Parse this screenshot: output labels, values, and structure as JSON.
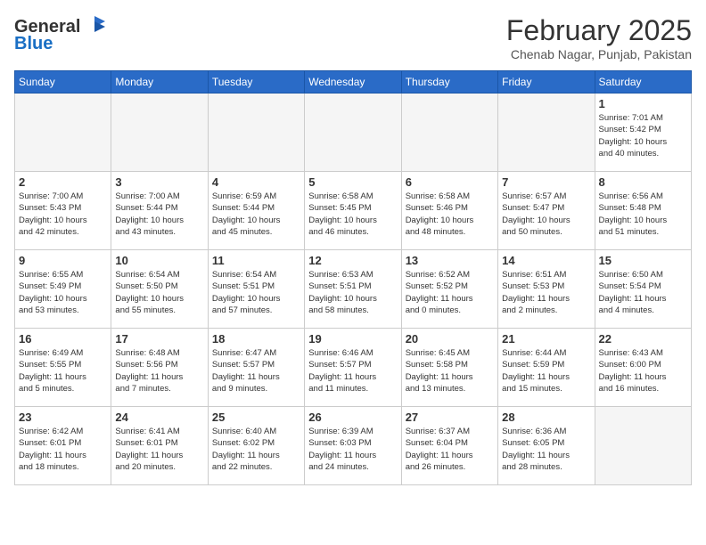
{
  "header": {
    "logo_general": "General",
    "logo_blue": "Blue",
    "month": "February 2025",
    "location": "Chenab Nagar, Punjab, Pakistan"
  },
  "weekdays": [
    "Sunday",
    "Monday",
    "Tuesday",
    "Wednesday",
    "Thursday",
    "Friday",
    "Saturday"
  ],
  "weeks": [
    [
      {
        "day": "",
        "info": ""
      },
      {
        "day": "",
        "info": ""
      },
      {
        "day": "",
        "info": ""
      },
      {
        "day": "",
        "info": ""
      },
      {
        "day": "",
        "info": ""
      },
      {
        "day": "",
        "info": ""
      },
      {
        "day": "1",
        "info": "Sunrise: 7:01 AM\nSunset: 5:42 PM\nDaylight: 10 hours\nand 40 minutes."
      }
    ],
    [
      {
        "day": "2",
        "info": "Sunrise: 7:00 AM\nSunset: 5:43 PM\nDaylight: 10 hours\nand 42 minutes."
      },
      {
        "day": "3",
        "info": "Sunrise: 7:00 AM\nSunset: 5:44 PM\nDaylight: 10 hours\nand 43 minutes."
      },
      {
        "day": "4",
        "info": "Sunrise: 6:59 AM\nSunset: 5:44 PM\nDaylight: 10 hours\nand 45 minutes."
      },
      {
        "day": "5",
        "info": "Sunrise: 6:58 AM\nSunset: 5:45 PM\nDaylight: 10 hours\nand 46 minutes."
      },
      {
        "day": "6",
        "info": "Sunrise: 6:58 AM\nSunset: 5:46 PM\nDaylight: 10 hours\nand 48 minutes."
      },
      {
        "day": "7",
        "info": "Sunrise: 6:57 AM\nSunset: 5:47 PM\nDaylight: 10 hours\nand 50 minutes."
      },
      {
        "day": "8",
        "info": "Sunrise: 6:56 AM\nSunset: 5:48 PM\nDaylight: 10 hours\nand 51 minutes."
      }
    ],
    [
      {
        "day": "9",
        "info": "Sunrise: 6:55 AM\nSunset: 5:49 PM\nDaylight: 10 hours\nand 53 minutes."
      },
      {
        "day": "10",
        "info": "Sunrise: 6:54 AM\nSunset: 5:50 PM\nDaylight: 10 hours\nand 55 minutes."
      },
      {
        "day": "11",
        "info": "Sunrise: 6:54 AM\nSunset: 5:51 PM\nDaylight: 10 hours\nand 57 minutes."
      },
      {
        "day": "12",
        "info": "Sunrise: 6:53 AM\nSunset: 5:51 PM\nDaylight: 10 hours\nand 58 minutes."
      },
      {
        "day": "13",
        "info": "Sunrise: 6:52 AM\nSunset: 5:52 PM\nDaylight: 11 hours\nand 0 minutes."
      },
      {
        "day": "14",
        "info": "Sunrise: 6:51 AM\nSunset: 5:53 PM\nDaylight: 11 hours\nand 2 minutes."
      },
      {
        "day": "15",
        "info": "Sunrise: 6:50 AM\nSunset: 5:54 PM\nDaylight: 11 hours\nand 4 minutes."
      }
    ],
    [
      {
        "day": "16",
        "info": "Sunrise: 6:49 AM\nSunset: 5:55 PM\nDaylight: 11 hours\nand 5 minutes."
      },
      {
        "day": "17",
        "info": "Sunrise: 6:48 AM\nSunset: 5:56 PM\nDaylight: 11 hours\nand 7 minutes."
      },
      {
        "day": "18",
        "info": "Sunrise: 6:47 AM\nSunset: 5:57 PM\nDaylight: 11 hours\nand 9 minutes."
      },
      {
        "day": "19",
        "info": "Sunrise: 6:46 AM\nSunset: 5:57 PM\nDaylight: 11 hours\nand 11 minutes."
      },
      {
        "day": "20",
        "info": "Sunrise: 6:45 AM\nSunset: 5:58 PM\nDaylight: 11 hours\nand 13 minutes."
      },
      {
        "day": "21",
        "info": "Sunrise: 6:44 AM\nSunset: 5:59 PM\nDaylight: 11 hours\nand 15 minutes."
      },
      {
        "day": "22",
        "info": "Sunrise: 6:43 AM\nSunset: 6:00 PM\nDaylight: 11 hours\nand 16 minutes."
      }
    ],
    [
      {
        "day": "23",
        "info": "Sunrise: 6:42 AM\nSunset: 6:01 PM\nDaylight: 11 hours\nand 18 minutes."
      },
      {
        "day": "24",
        "info": "Sunrise: 6:41 AM\nSunset: 6:01 PM\nDaylight: 11 hours\nand 20 minutes."
      },
      {
        "day": "25",
        "info": "Sunrise: 6:40 AM\nSunset: 6:02 PM\nDaylight: 11 hours\nand 22 minutes."
      },
      {
        "day": "26",
        "info": "Sunrise: 6:39 AM\nSunset: 6:03 PM\nDaylight: 11 hours\nand 24 minutes."
      },
      {
        "day": "27",
        "info": "Sunrise: 6:37 AM\nSunset: 6:04 PM\nDaylight: 11 hours\nand 26 minutes."
      },
      {
        "day": "28",
        "info": "Sunrise: 6:36 AM\nSunset: 6:05 PM\nDaylight: 11 hours\nand 28 minutes."
      },
      {
        "day": "",
        "info": ""
      }
    ]
  ]
}
